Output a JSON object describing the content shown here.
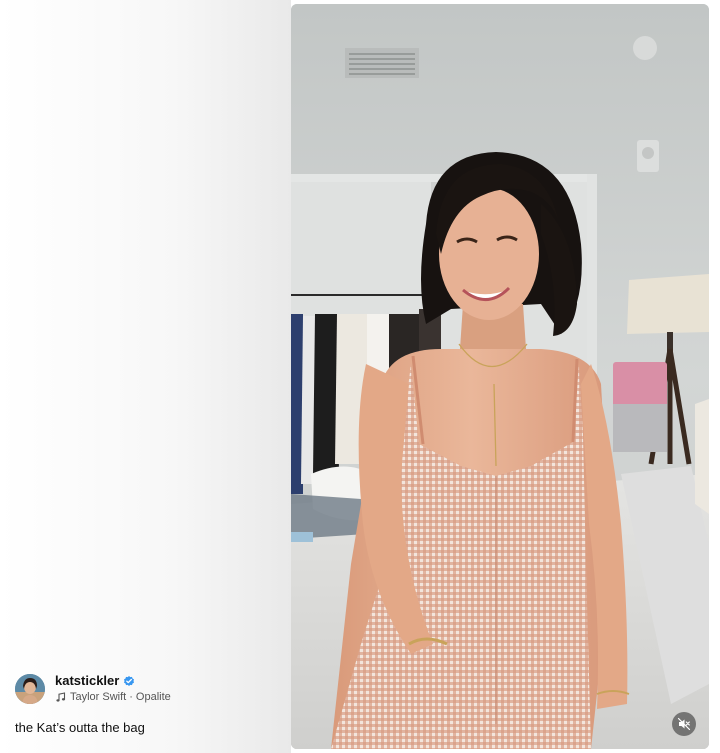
{
  "post": {
    "username": "katstickler",
    "verified": true,
    "audio": {
      "artist": "Taylor Swift",
      "separator": "·",
      "track": "Opalite"
    },
    "caption": "the Kat’s outta the bag"
  },
  "video": {
    "muted": true,
    "mute_icon": "speaker-muted-icon"
  },
  "colors": {
    "verified_badge": "#3897f0",
    "text_primary": "#111111",
    "text_secondary": "#555555",
    "mute_button_bg": "#282828"
  },
  "icons": {
    "verified": "verified-badge-icon",
    "music": "music-note-icon"
  }
}
